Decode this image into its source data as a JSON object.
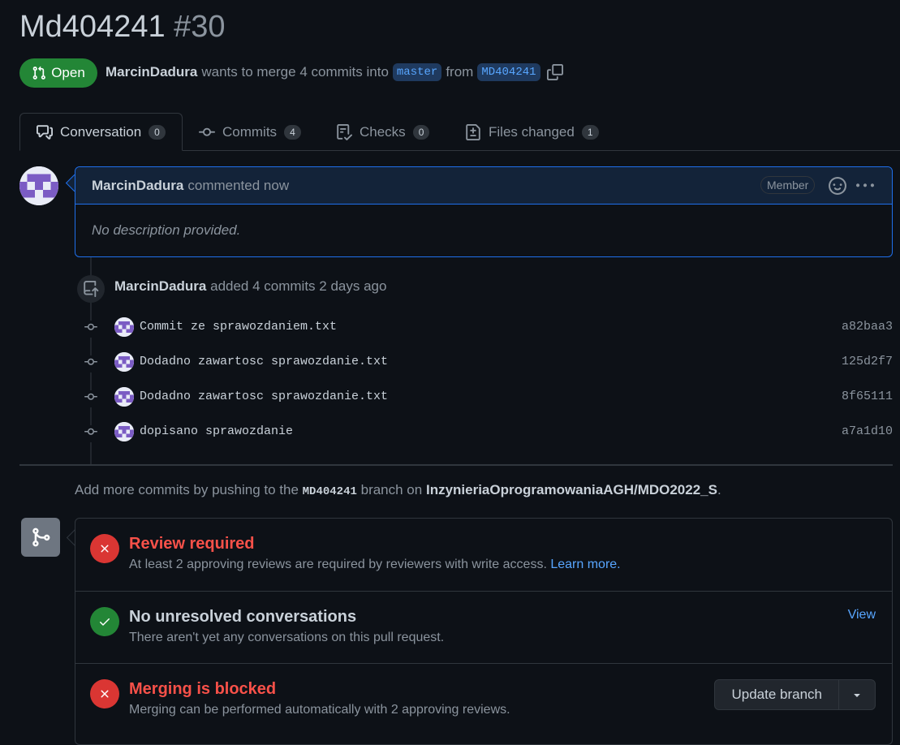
{
  "pr": {
    "title": "Md404241",
    "number": "#30",
    "state": "Open",
    "author": "MarcinDadura",
    "merge_text": "wants to merge 4 commits into",
    "base_branch": "master",
    "from_text": "from",
    "head_branch": "MD404241"
  },
  "tabs": [
    {
      "label": "Conversation",
      "count": "0",
      "icon": "comment-discussion-icon"
    },
    {
      "label": "Commits",
      "count": "4",
      "icon": "git-commit-icon"
    },
    {
      "label": "Checks",
      "count": "0",
      "icon": "checklist-icon"
    },
    {
      "label": "Files changed",
      "count": "1",
      "icon": "file-diff-icon"
    }
  ],
  "comment": {
    "author": "MarcinDadura",
    "time": "commented now",
    "role": "Member",
    "body": "No description provided."
  },
  "push_event": {
    "author": "MarcinDadura",
    "text": "added 4 commits 2 days ago"
  },
  "commits": [
    {
      "message": "Commit ze sprawozdaniem.txt",
      "sha": "a82baa3"
    },
    {
      "message": "Dodadno zawartosc sprawozdanie.txt",
      "sha": "125d2f7"
    },
    {
      "message": "Dodadno zawartosc sprawozdanie.txt",
      "sha": "8f65111"
    },
    {
      "message": "dopisano sprawozdanie",
      "sha": "a7a1d10"
    }
  ],
  "hint": {
    "prefix": "Add more commits by pushing to the",
    "branch": "MD404241",
    "middle": "branch on",
    "repo": "InzynieriaOprogramowaniaAGH/MDO2022_S",
    "suffix": "."
  },
  "merge": {
    "review": {
      "title": "Review required",
      "subtitle": "At least 2 approving reviews are required by reviewers with write access.",
      "link": "Learn more."
    },
    "conversations": {
      "title": "No unresolved conversations",
      "subtitle": "There aren't yet any conversations on this pull request.",
      "link": "View"
    },
    "blocked": {
      "title": "Merging is blocked",
      "subtitle": "Merging can be performed automatically with 2 approving reviews.",
      "button": "Update branch"
    }
  },
  "colors": {
    "background": "#0d1117",
    "open_green": "#238636",
    "error_red": "#da3633",
    "link_blue": "#58a6ff",
    "muted": "#8b949e"
  }
}
